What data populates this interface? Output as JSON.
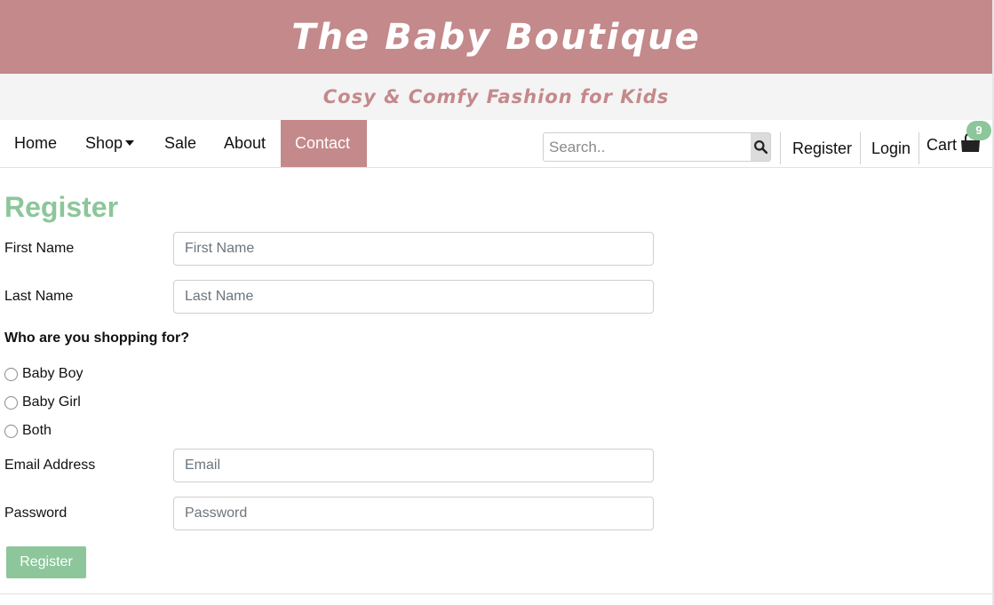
{
  "header": {
    "brand": "The Baby Boutique",
    "tagline": "Cosy & Comfy Fashion for Kids"
  },
  "nav": {
    "items": [
      {
        "label": "Home"
      },
      {
        "label": "Shop"
      },
      {
        "label": "Sale"
      },
      {
        "label": "About"
      },
      {
        "label": "Contact",
        "active": true
      }
    ],
    "search_placeholder": "Search..",
    "register_label": "Register",
    "login_label": "Login",
    "cart_label": "Cart",
    "cart_count": "9"
  },
  "form": {
    "title": "Register",
    "first_name_label": "First Name",
    "first_name_placeholder": "First Name",
    "last_name_label": "Last Name",
    "last_name_placeholder": "Last Name",
    "question": "Who are you shopping for?",
    "options": [
      "Baby Boy",
      "Baby Girl",
      "Both"
    ],
    "email_label": "Email Address",
    "email_placeholder": "Email",
    "password_label": "Password",
    "password_placeholder": "Password",
    "submit_label": "Register"
  },
  "colors": {
    "brand_pink": "#c4898b",
    "accent_green": "#8cc69a"
  }
}
